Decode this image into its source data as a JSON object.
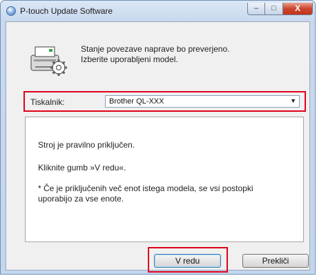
{
  "window": {
    "title": "P-touch Update Software",
    "controls": {
      "minimize": "–",
      "maximize": "□",
      "close": "X"
    }
  },
  "header": {
    "line1": "Stanje povezave naprave bo preverjeno.",
    "line2": "Izberite uporabljeni model.",
    "icon": "printer-settings-icon"
  },
  "printer": {
    "label": "Tiskalnik:",
    "selected": "Brother QL-XXX"
  },
  "info": {
    "line1": "Stroj je pravilno priključen.",
    "line2": "Kliknite gumb »V redu«.",
    "line3": "* Če je priključenih več enot istega modela, se vsi postopki",
    "line4": "uporabijo za vse enote."
  },
  "buttons": {
    "ok": "V redu",
    "cancel": "Prekliči"
  },
  "colors": {
    "highlight": "#e0001a",
    "title_bar": "#c8d8ee",
    "close_button": "#c9462d"
  }
}
